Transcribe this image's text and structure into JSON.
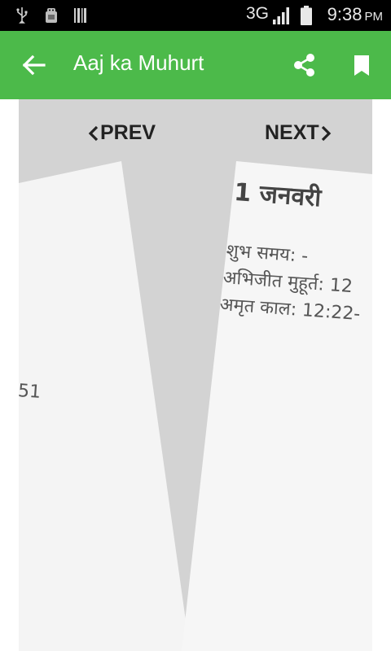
{
  "status_bar": {
    "network": "3G",
    "time": "9:38",
    "ampm": "PM",
    "icons": [
      "usb-icon",
      "android-debug-icon",
      "barcode-icon",
      "signal-icon",
      "battery-icon"
    ]
  },
  "app_bar": {
    "title": "Aaj ka Muhurt",
    "color": "#4cba4a",
    "icons": [
      "back-arrow-icon",
      "share-icon",
      "bookmark-icon"
    ]
  },
  "navigation": {
    "prev_label": "PREV",
    "next_label": "NEXT"
  },
  "right_page": {
    "date": "1 जनवरी",
    "shubh_samay": "शुभ समय: -",
    "abhijit_muhurt": "अभिजीत मुहूर्त: 12",
    "amrit_kaal": "अमृत काल: 12:22-"
  },
  "left_page": {
    "fragment": "51"
  }
}
